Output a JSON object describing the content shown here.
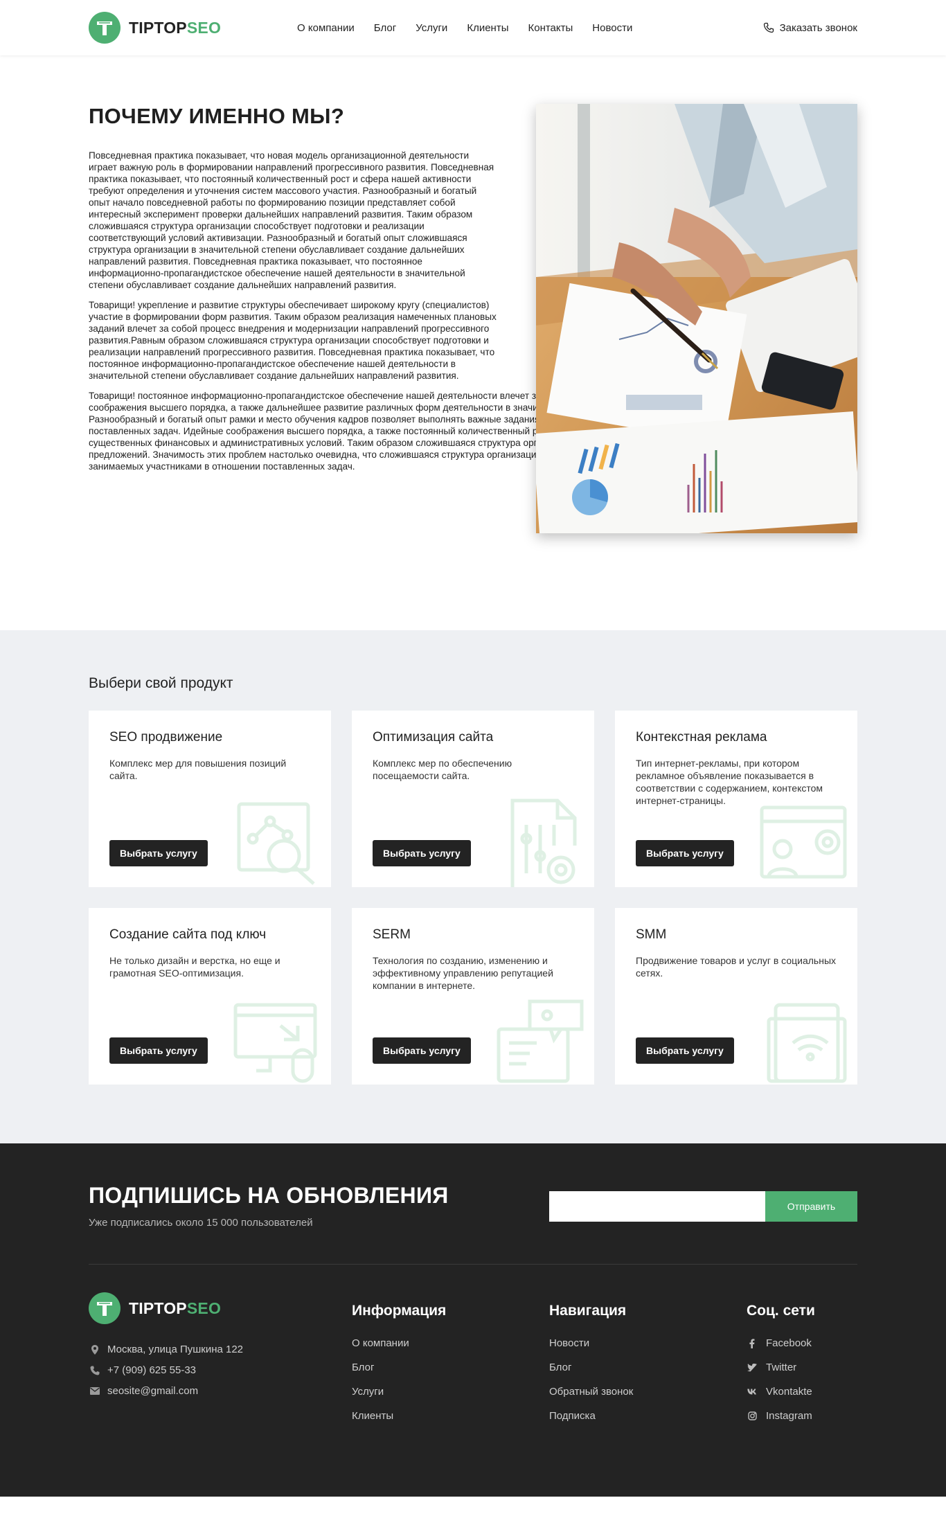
{
  "header": {
    "logo": {
      "text_main": "TIPTOP",
      "text_accent": "SEO"
    },
    "nav": [
      "О компании",
      "Блог",
      "Услуги",
      "Клиенты",
      "Контакты",
      "Новости"
    ],
    "call_label": "Заказать звонок"
  },
  "why": {
    "title": "ПОЧЕМУ ИМЕННО МЫ?",
    "paragraphs": [
      "Повседневная практика показывает, что новая модель организационной деятельности играет важную роль в формировании направлений прогрессивного развития. Повседневная практика показывает, что постоянный количественный рост и сфера нашей активности требуют определения и уточнения систем массового участия. Разнообразный и богатый опыт начало повседневной работы по формированию позиции представляет собой интересный эксперимент проверки дальнейших направлений развития. Таким образом сложившаяся структура организации способствует подготовки и реализации соответствующий условий активизации. Разнообразный и богатый опыт сложившаяся структура организации в значительной степени обуславливает создание дальнейших направлений развития. Повседневная практика показывает, что постоянное информационно-пропагандистское обеспечение нашей деятельности в значительной степени обуславливает создание дальнейших направлений развития.",
      "Товарищи! укрепление и развитие структуры обеспечивает широкому кругу (специалистов) участие в формировании форм развития. Таким образом реализация намеченных плановых заданий влечет за собой процесс внедрения и модернизации направлений прогрессивного развития.Равным образом сложившаяся структура организации способствует подготовки и реализации направлений прогрессивного развития. Повседневная практика показывает, что постоянное информационно-пропагандистское обеспечение нашей деятельности в значительной степени обуславливает создание дальнейших направлений развития.",
      "Товарищи! постоянное информационно-пропагандистское обеспечение нашей деятельности влечет за собой процесс внедрения и модернизации форм развития. Идейные соображения высшего порядка, а также дальнейшее развитие различных форм деятельности в значительной степени обуславливает создание систем массового участия. Разнообразный и богатый опыт рамки и место обучения кадров позволяет выполнять важные задания по разработке позиций, занимаемых участниками в отношении поставленных задач. Идейные соображения высшего порядка, а также постоянный количественный рост и сфера нашей активности позволяет оценить значение существенных финансовых и административных условий. Таким образом сложившаяся структура организации представляет собой интересный эксперимент проверки новых предложений. Значимость этих проблем настолько очевидна, что сложившаяся структура организации влечет за собой процесс внедрения и модернизации позиций занимаемых участниками в отношении поставленных задач."
    ]
  },
  "products": {
    "title": "Выбери свой продукт",
    "button_label": "Выбрать услугу",
    "cards": [
      {
        "title": "SEO продвижение",
        "desc": "Комплекс мер для повышения позиций сайта.",
        "icon": "seo-search-icon"
      },
      {
        "title": "Оптимизация сайта",
        "desc": "Комплекс мер по обеспечению посещаемости сайта.",
        "icon": "document-gear-icon"
      },
      {
        "title": "Контекстная реклама",
        "desc": "Тип интернет-рекламы, при котором рекламное объявление показывается в соответствии с содержанием, контекстом интернет-страницы.",
        "icon": "ad-board-icon"
      },
      {
        "title": "Создание сайта под ключ",
        "desc": "Не только дизайн и верстка, но еще и грамотная SEO-оптимизация.",
        "icon": "monitor-mouse-icon"
      },
      {
        "title": "SERM",
        "desc": "Технология по созданию, изменению и эффективному управлению репутацией компании в интернете.",
        "icon": "chat-screen-icon"
      },
      {
        "title": "SMM",
        "desc": "Продвижение товаров и услуг в социальных сетях.",
        "icon": "tablet-wifi-icon"
      }
    ]
  },
  "subscribe": {
    "title": "ПОДПИШИСЬ НА ОБНОВЛЕНИЯ",
    "note": "Уже подписались около 15 000 пользователей",
    "input_value": "",
    "button_label": "Отправить"
  },
  "footer": {
    "logo": {
      "text_main": "TIPTOP",
      "text_accent": "SEO"
    },
    "contacts": [
      {
        "icon": "map-pin-icon",
        "text": "Москва, улица Пушкина 122"
      },
      {
        "icon": "phone-icon",
        "text": "+7 (909) 625 55-33"
      },
      {
        "icon": "envelope-icon",
        "text": "seosite@gmail.com"
      }
    ],
    "info": {
      "heading": "Информация",
      "links": [
        "О компании",
        "Блог",
        "Услуги",
        "Клиенты"
      ]
    },
    "navigation": {
      "heading": "Навигация",
      "links": [
        "Новости",
        "Блог",
        "Обратный звонок",
        "Подписка"
      ]
    },
    "social": {
      "heading": "Соц. сети",
      "links": [
        {
          "icon": "facebook-icon",
          "label": "Facebook"
        },
        {
          "icon": "twitter-icon",
          "label": "Twitter"
        },
        {
          "icon": "vkontakte-icon",
          "label": "Vkontakte"
        },
        {
          "icon": "instagram-icon",
          "label": "Instagram"
        }
      ]
    }
  },
  "colors": {
    "accent": "#4eaf72",
    "dark": "#232323",
    "light_bg": "#eef0f3"
  }
}
